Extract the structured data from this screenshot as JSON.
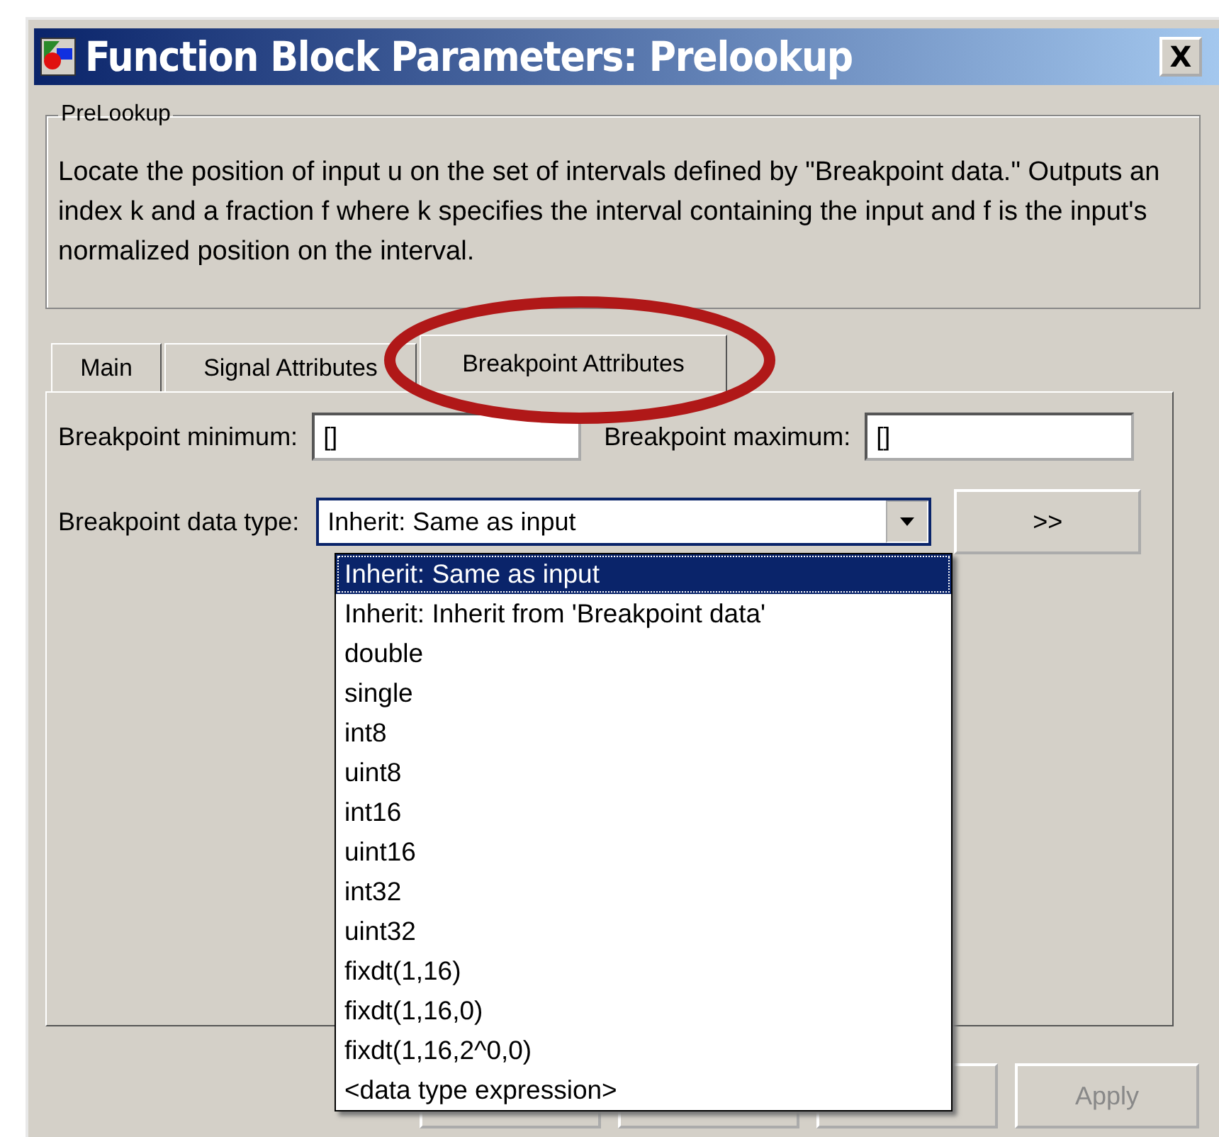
{
  "window": {
    "title": "Function Block Parameters: Prelookup",
    "close": "X"
  },
  "group": {
    "title": "PreLookup",
    "description": "Locate the position of input u on the set of intervals defined by \"Breakpoint data.\" Outputs an index k and a fraction f where k specifies the interval containing the input and f is the input's normalized position on the interval."
  },
  "tabs": [
    {
      "label": "Main",
      "selected": false
    },
    {
      "label": "Signal Attributes",
      "selected": false
    },
    {
      "label": "Breakpoint Attributes",
      "selected": true
    }
  ],
  "fields": [
    {
      "label": "Breakpoint minimum:",
      "value": "[]"
    },
    {
      "label": "Breakpoint maximum:",
      "value": "[]"
    }
  ],
  "data_type": {
    "label": "Breakpoint data type:",
    "value": "Inherit: Same as input",
    "assistant": ">>",
    "expanded": true,
    "options": [
      {
        "label": "Inherit: Same as input",
        "selected": true
      },
      {
        "label": "Inherit: Inherit from 'Breakpoint data'",
        "selected": false
      },
      {
        "label": "double",
        "selected": false
      },
      {
        "label": "single",
        "selected": false
      },
      {
        "label": "int8",
        "selected": false
      },
      {
        "label": "uint8",
        "selected": false
      },
      {
        "label": "int16",
        "selected": false
      },
      {
        "label": "uint16",
        "selected": false
      },
      {
        "label": "int32",
        "selected": false
      },
      {
        "label": "uint32",
        "selected": false
      },
      {
        "label": "fixdt(1,16)",
        "selected": false
      },
      {
        "label": "fixdt(1,16,0)",
        "selected": false
      },
      {
        "label": "fixdt(1,16,2^0,0)",
        "selected": false
      },
      {
        "label": "<data type expression>",
        "selected": false
      }
    ]
  },
  "buttons": [
    {
      "label": "Apply",
      "disabled": true
    }
  ]
}
